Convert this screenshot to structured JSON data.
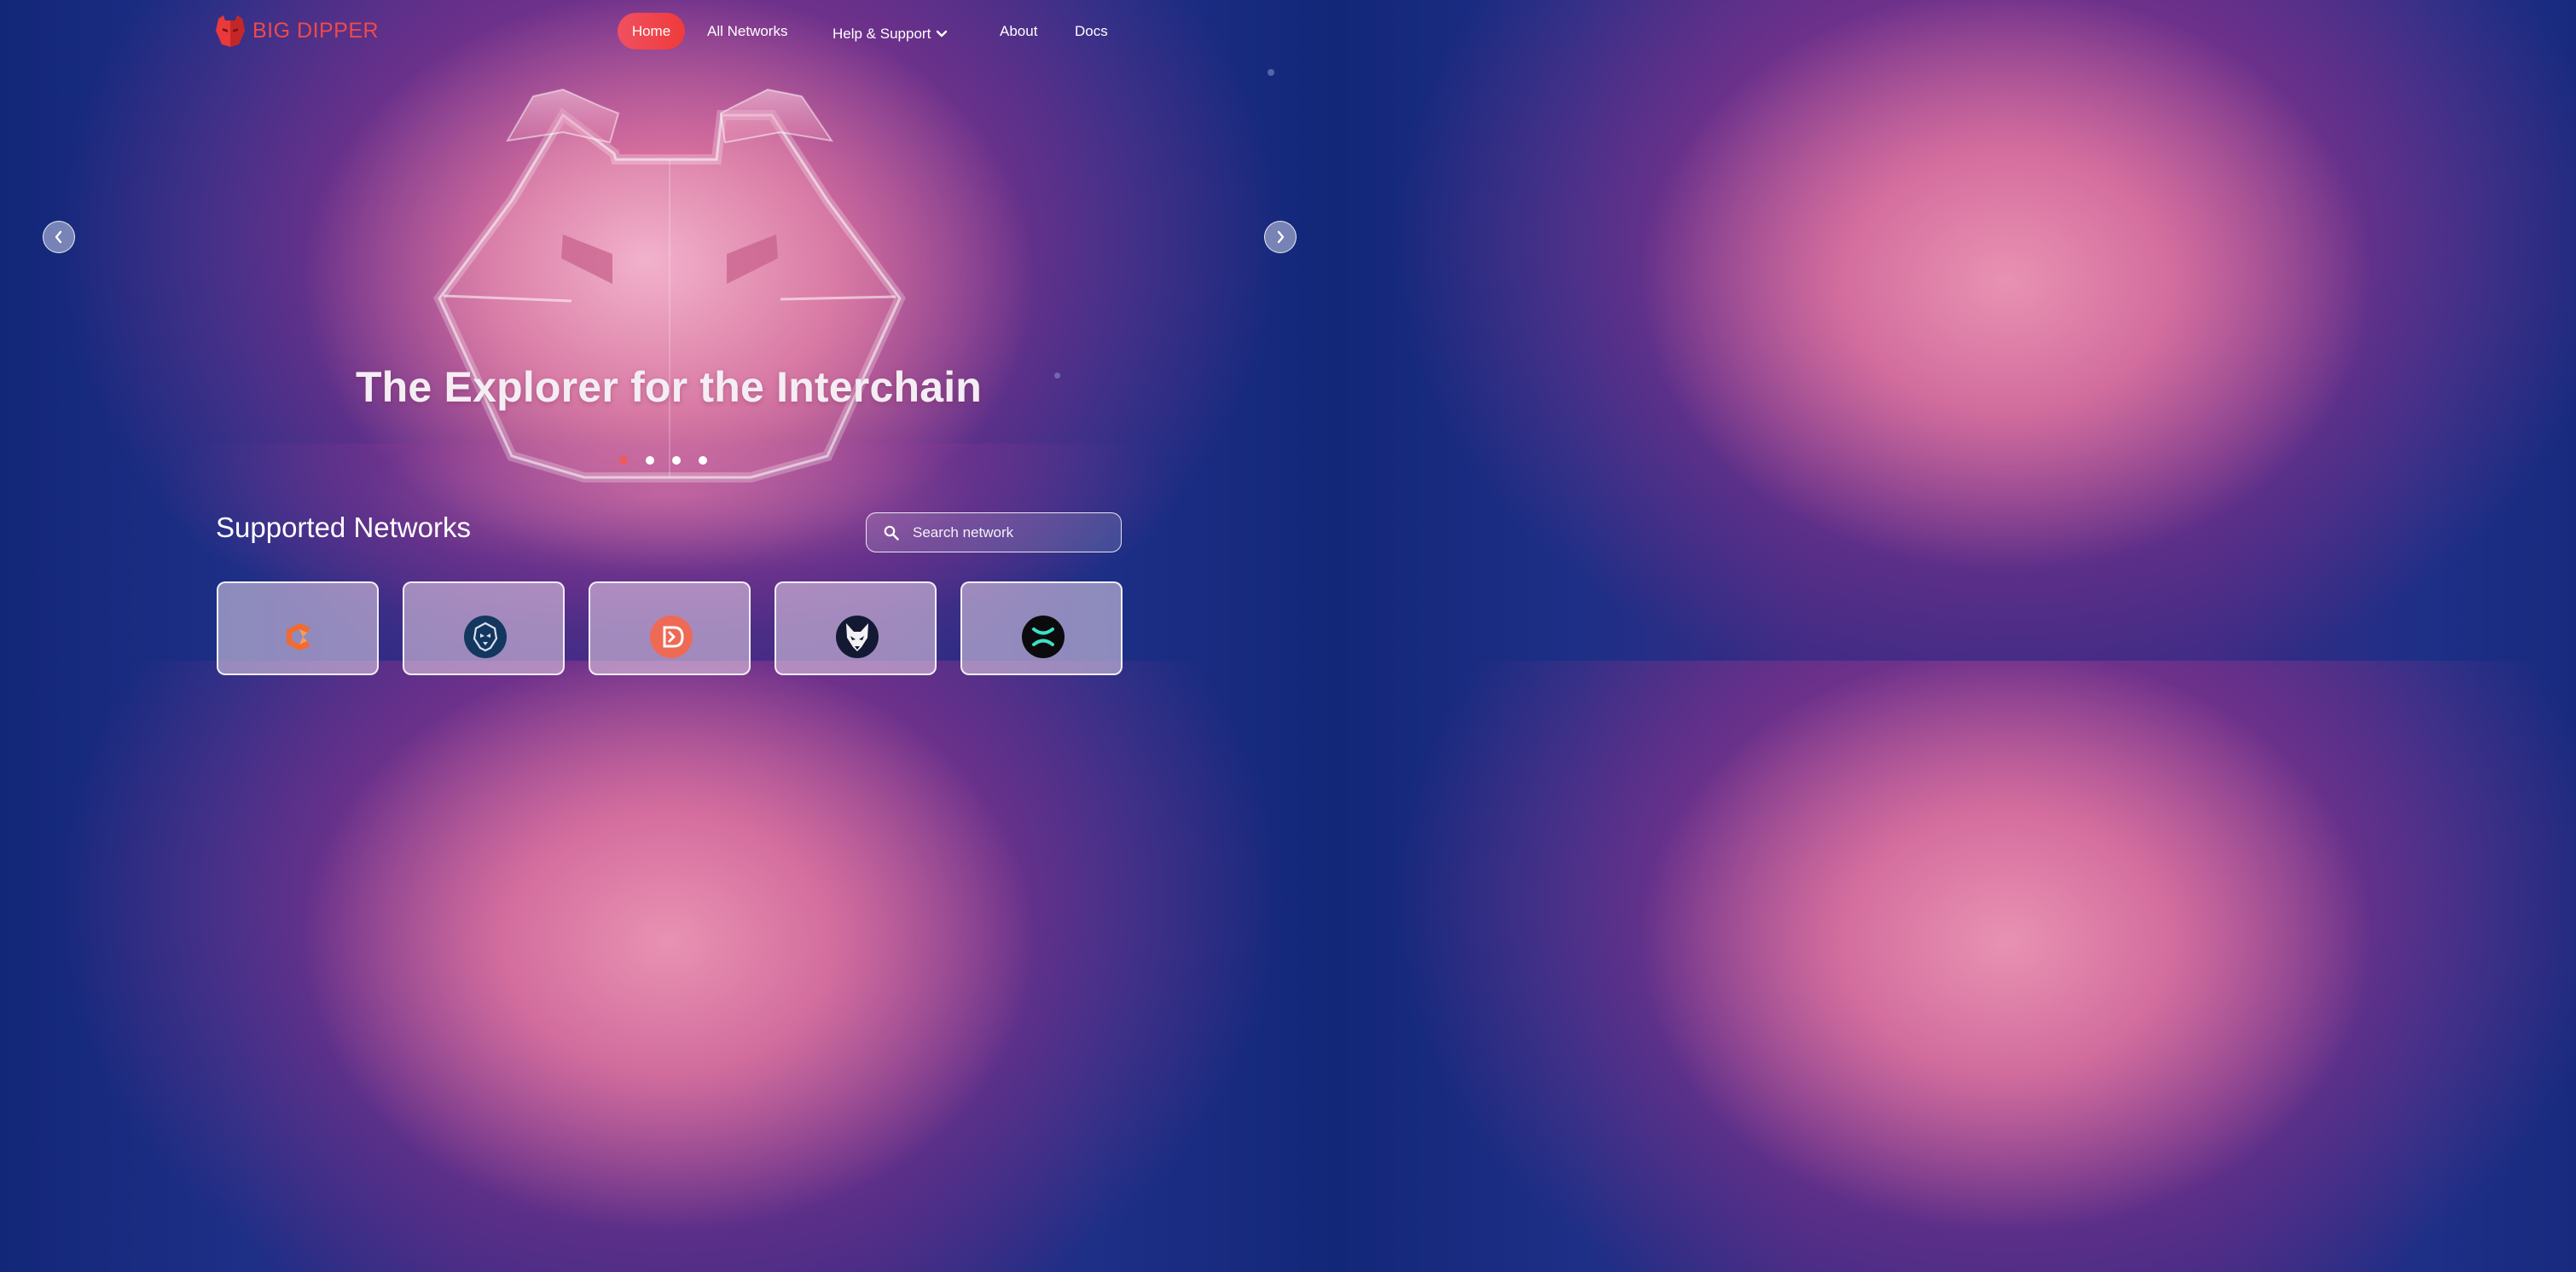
{
  "brand": {
    "name": "BIG DIPPER",
    "accent_color": "#ef4a4a"
  },
  "nav": {
    "home": "Home",
    "all_networks": "All Networks",
    "help_support": "Help & Support",
    "about": "About",
    "docs": "Docs"
  },
  "hero": {
    "title": "The Explorer for the Interchain",
    "slide_count": 4,
    "active_slide": 1
  },
  "networks": {
    "section_title": "Supported Networks",
    "search_placeholder": "Search network",
    "cards": [
      {
        "icon": "orange-c-network-icon"
      },
      {
        "icon": "lion-network-icon"
      },
      {
        "icon": "coral-d-network-icon"
      },
      {
        "icon": "fox-network-icon"
      },
      {
        "icon": "green-x-network-icon"
      }
    ]
  }
}
